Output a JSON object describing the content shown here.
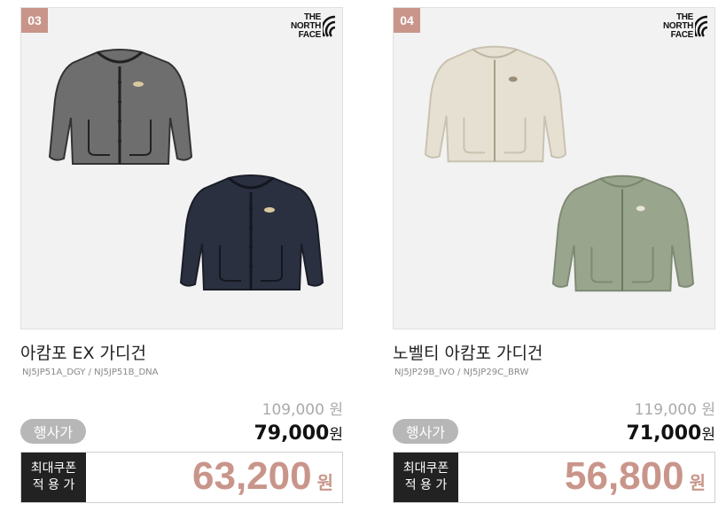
{
  "products": [
    {
      "number": "03",
      "brand_text": "THE\nNORTH\nFACE",
      "name": "아캄포 EX 가디건",
      "code": "NJ5JP51A_DGY / NJ5JP51B_DNA",
      "original_price": "109,000",
      "original_currency": "원",
      "sale_label": "행사가",
      "sale_price": "79,000",
      "sale_currency": "원",
      "coupon_label_line1": "최대쿠폰",
      "coupon_label_line2": "적 용 가",
      "coupon_price": "63,200",
      "coupon_currency": "원",
      "colors": [
        "#6e6e6e",
        "#2b3040"
      ]
    },
    {
      "number": "04",
      "brand_text": "THE\nNORTH\nFACE",
      "name": "노벨티 아캄포 가디건",
      "code": "NJ5JP29B_IVO / NJ5JP29C_BRW",
      "original_price": "119,000",
      "original_currency": "원",
      "sale_label": "행사가",
      "sale_price": "71,000",
      "sale_currency": "원",
      "coupon_label_line1": "최대쿠폰",
      "coupon_label_line2": "적 용 가",
      "coupon_price": "56,800",
      "coupon_currency": "원",
      "colors": [
        "#e6e0d2",
        "#9aa58e"
      ]
    }
  ],
  "accent_color": "#c9958a",
  "icons": [
    "north-face-logo-icon",
    "cardigan-image-icon"
  ]
}
